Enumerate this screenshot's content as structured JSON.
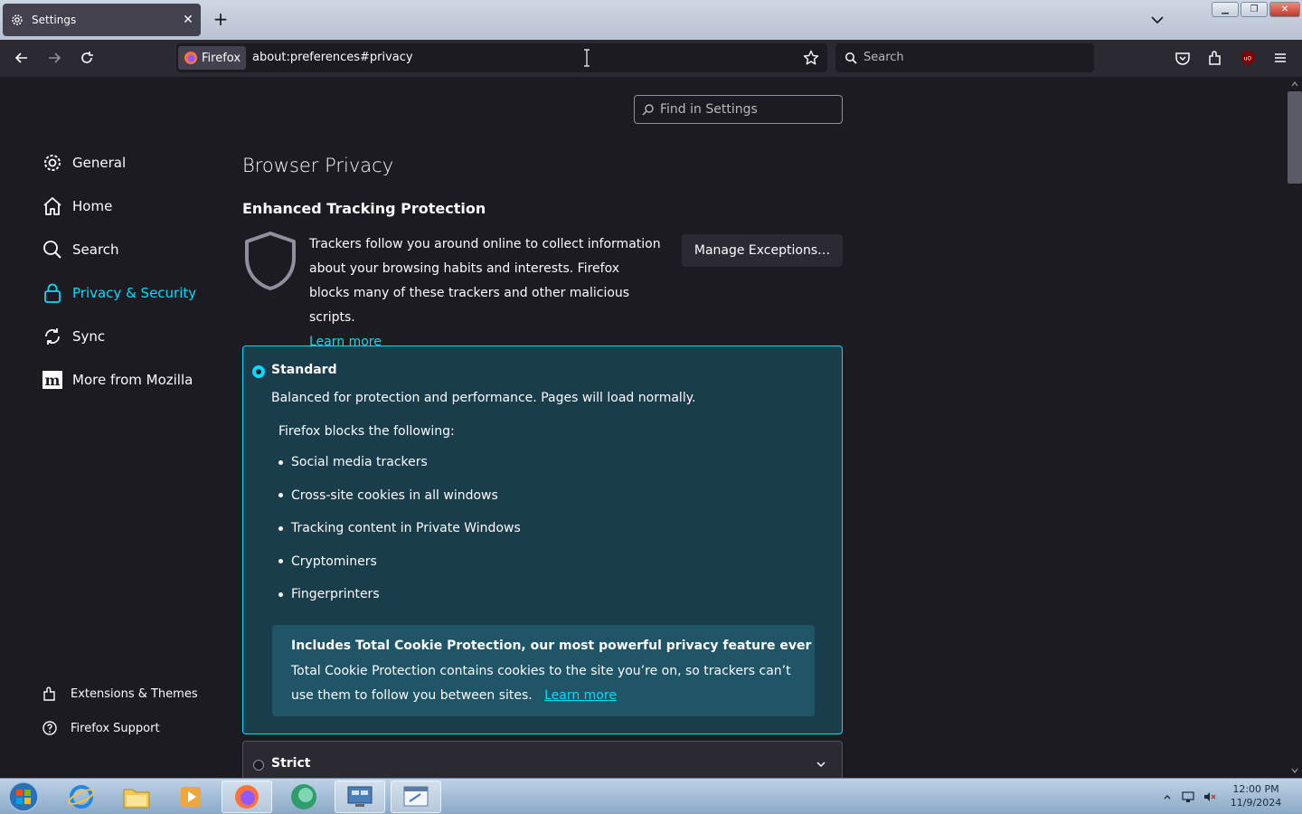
{
  "browser": {
    "tab": {
      "title": "Settings",
      "icon": "gear-icon"
    },
    "url": {
      "identity_label": "Firefox",
      "address": "about:preferences#privacy"
    },
    "search_placeholder": "Search"
  },
  "settings": {
    "find_placeholder": "Find in Settings",
    "sidebar": {
      "items": [
        {
          "label": "General",
          "icon": "gear-icon"
        },
        {
          "label": "Home",
          "icon": "home-icon"
        },
        {
          "label": "Search",
          "icon": "search-icon"
        },
        {
          "label": "Privacy & Security",
          "icon": "lock-icon",
          "selected": true
        },
        {
          "label": "Sync",
          "icon": "sync-icon"
        },
        {
          "label": "More from Mozilla",
          "icon": "mozilla-icon"
        }
      ],
      "footer": [
        {
          "label": "Extensions & Themes",
          "icon": "puzzle-icon"
        },
        {
          "label": "Firefox Support",
          "icon": "help-icon"
        }
      ]
    },
    "page_title": "Browser Privacy",
    "etp": {
      "title": "Enhanced Tracking Protection",
      "description": "Trackers follow you around online to collect information about your browsing habits and interests. Firefox blocks many of these trackers and other malicious scripts.",
      "learn_more": "Learn more",
      "manage_button": "Manage Exceptions…"
    },
    "standard": {
      "label": "Standard",
      "description": "Balanced for protection and performance. Pages will load normally.",
      "blocks_heading": "Firefox blocks the following:",
      "blocks": [
        "Social media trackers",
        "Cross-site cookies in all windows",
        "Tracking content in Private Windows",
        "Cryptominers",
        "Fingerprinters"
      ],
      "tcp": {
        "title": "Includes Total Cookie Protection, our most powerful privacy feature ever",
        "body": "Total Cookie Protection contains cookies to the site you’re on, so trackers can’t use them to follow you between sites.",
        "learn_more": "Learn more"
      }
    },
    "strict": {
      "label": "Strict"
    }
  },
  "taskbar": {
    "clock_time": "12:00 PM",
    "clock_date": "11/9/2024"
  },
  "colors": {
    "accent": "#00ddff",
    "card_bg": "#1a3d4c",
    "page_bg": "#1c1b22"
  }
}
